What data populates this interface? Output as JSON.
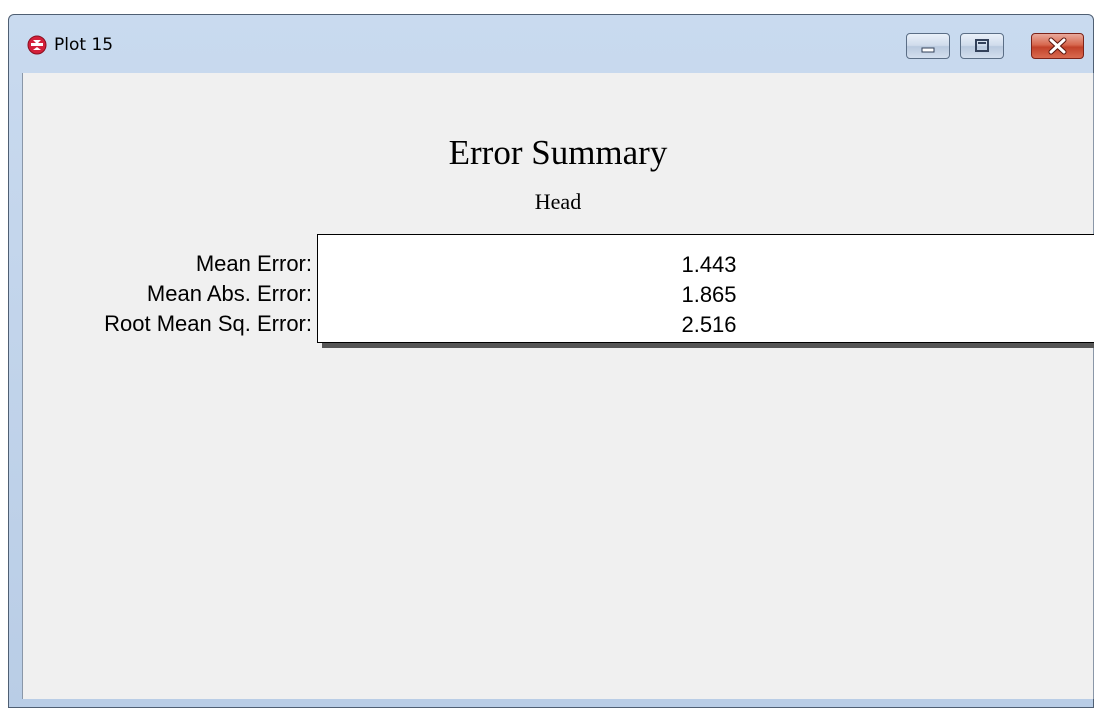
{
  "window": {
    "title": "Plot 15",
    "icon": "app-logo-icon",
    "controls": [
      "minimize-icon",
      "maximize-icon",
      "close-icon"
    ]
  },
  "plot": {
    "title": "Error Summary",
    "subtitle": "Head",
    "rows": [
      {
        "label": "Mean Error:",
        "value": "1.443"
      },
      {
        "label": "Mean Abs. Error:",
        "value": "1.865"
      },
      {
        "label": "Root Mean Sq. Error:",
        "value": "2.516"
      }
    ]
  },
  "colors": {
    "titlebar": "#c9daef",
    "client_background": "#f0f0f0",
    "close_button": "#c2422a",
    "app_icon": "#d3203a"
  }
}
